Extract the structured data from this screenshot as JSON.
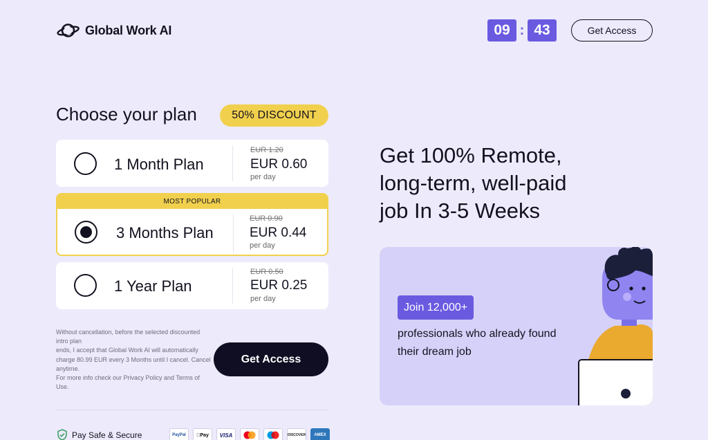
{
  "header": {
    "brand": "Global Work AI",
    "timer": {
      "minutes": "09",
      "separator": ":",
      "seconds": "43"
    },
    "access_label": "Get Access"
  },
  "plans": {
    "title": "Choose your plan",
    "discount_badge": "50% DISCOUNT",
    "items": [
      {
        "name": "1 Month Plan",
        "old_price": "EUR 1.20",
        "price": "EUR 0.60",
        "per": "per day",
        "selected": false
      },
      {
        "name": "3 Months Plan",
        "old_price": "EUR 0.90",
        "price": "EUR 0.44",
        "per": "per day",
        "selected": true,
        "badge": "MOST POPULAR"
      },
      {
        "name": "1 Year Plan",
        "old_price": "EUR 0.50",
        "price": "EUR 0.25",
        "per": "per day",
        "selected": false
      }
    ]
  },
  "disclaimer": {
    "line1": "Without cancellation, before the selected discounted intro plan",
    "line2": "ends, I accept that Global Work AI will automatically charge 80.99 EUR every 3 Months until I cancel. Cancel anytime.",
    "line3": "For more info check our Privacy Policy and Terms of Use."
  },
  "cta_label": "Get Access",
  "footer": {
    "secure_label": "Pay Safe & Secure",
    "payment_methods": [
      "PayPal",
      "Pay",
      "VISA",
      "Mastercard",
      "Maestro",
      "DISCOVER",
      "AMEX"
    ]
  },
  "hero": {
    "line1": "Get 100% Remote,",
    "line2": "long-term, well-paid",
    "line3": "job In 3-5 Weeks"
  },
  "promo": {
    "badge": "Join 12,000+",
    "text": "professionals who already found their dream job"
  },
  "colors": {
    "background": "#edebfb",
    "accent": "#6a5ae0",
    "highlight": "#f1d04d",
    "dark": "#0f0e22"
  }
}
